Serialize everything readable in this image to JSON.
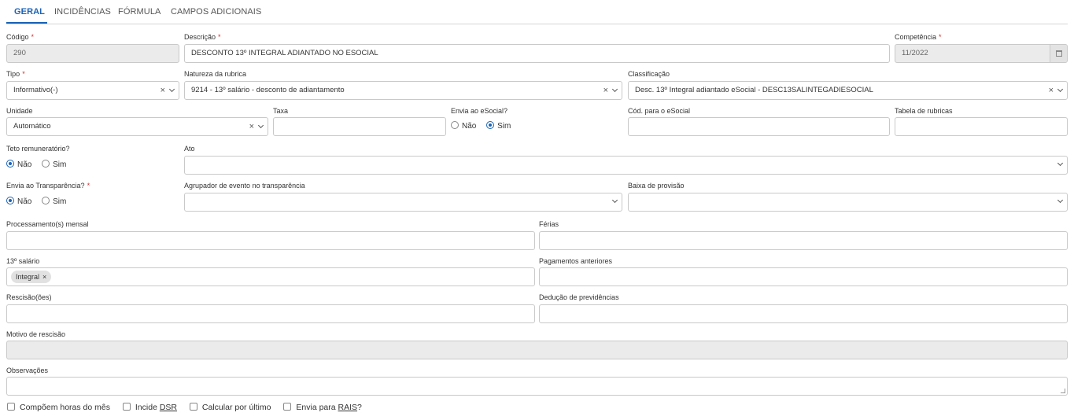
{
  "tabs": [
    "GERAL",
    "INCIDÊNCIAS",
    "FÓRMULA",
    "CAMPOS ADICIONAIS"
  ],
  "fields": {
    "codigo": {
      "label": "Código",
      "value": "290"
    },
    "descricao": {
      "label": "Descrição",
      "value": "DESCONTO 13º INTEGRAL ADIANTADO NO ESOCIAL"
    },
    "competencia": {
      "label": "Competência",
      "value": "11/2022"
    },
    "tipo": {
      "label": "Tipo",
      "value": "Informativo(-)"
    },
    "natureza": {
      "label": "Natureza da rubrica",
      "value": "9214 - 13º salário - desconto de adiantamento"
    },
    "classificacao": {
      "label": "Classificação",
      "value": "Desc. 13º Integral adiantado eSocial - DESC13SALINTEGADIESOCIAL"
    },
    "unidade": {
      "label": "Unidade",
      "value": "Automático"
    },
    "taxa": {
      "label": "Taxa",
      "value": ""
    },
    "envia_esocial": {
      "label": "Envia ao eSocial?",
      "options": [
        "Não",
        "Sim"
      ],
      "selected": "Sim"
    },
    "cod_esocial": {
      "label": "Cód. para o eSocial",
      "value": ""
    },
    "tabela_rubricas": {
      "label": "Tabela de rubricas",
      "value": ""
    },
    "teto": {
      "label": "Teto remuneratório?",
      "options": [
        "Não",
        "Sim"
      ],
      "selected": "Não"
    },
    "ato": {
      "label": "Ato",
      "value": ""
    },
    "envia_transparencia": {
      "label": "Envia ao Transparência?",
      "options": [
        "Não",
        "Sim"
      ],
      "selected": "Não"
    },
    "agrupador": {
      "label": "Agrupador de evento no transparência",
      "value": ""
    },
    "baixa_provisao": {
      "label": "Baixa de provisão",
      "value": ""
    },
    "processamento_mensal": {
      "label": "Processamento(s) mensal",
      "value": ""
    },
    "ferias": {
      "label": "Férias",
      "value": ""
    },
    "decimo_terceiro": {
      "label": "13º salário",
      "chips": [
        "Integral"
      ]
    },
    "pagamentos_anteriores": {
      "label": "Pagamentos anteriores",
      "value": ""
    },
    "rescisao": {
      "label": "Rescisão(ões)",
      "value": ""
    },
    "deducao_previdencias": {
      "label": "Dedução de previdências",
      "value": ""
    },
    "motivo_rescisao": {
      "label": "Motivo de rescisão",
      "value": ""
    },
    "observacoes": {
      "label": "Observações",
      "value": ""
    }
  },
  "checkboxes": [
    {
      "pre": "Compõem horas do mês",
      "u": "",
      "post": ""
    },
    {
      "pre": "Incide ",
      "u": "DSR",
      "post": ""
    },
    {
      "pre": "Calcular por último",
      "u": "",
      "post": ""
    },
    {
      "pre": "Envia para ",
      "u": "RAIS",
      "post": "?"
    }
  ],
  "glyphs": {
    "clear": "×",
    "chip_remove": "×",
    "required": "*"
  },
  "colors": {
    "accent": "#1a63b8",
    "required": "#d32f2f",
    "disabled_bg": "#ebebeb"
  }
}
